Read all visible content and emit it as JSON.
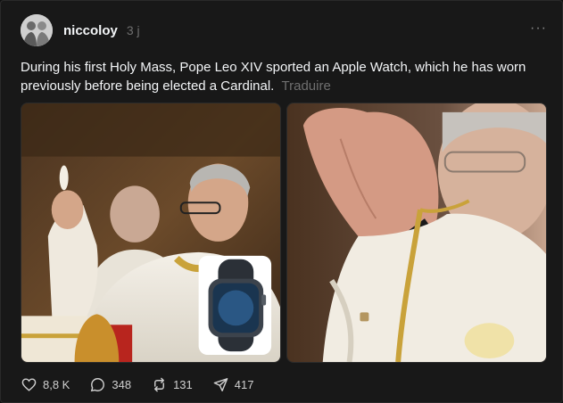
{
  "post": {
    "username": "niccoloy",
    "time": "3 j",
    "more_label": "···",
    "caption": "During his first Holy Mass, Pope Leo XIV sported an Apple Watch, which he has worn previously before being elected a Cardinal.",
    "translate_label": "Traduire",
    "media": [
      {
        "icon": "photo-mass-host-elevation"
      },
      {
        "icon": "photo-closeup-hands-watch"
      }
    ],
    "actions": {
      "likes": "8,8 K",
      "comments": "348",
      "reposts": "131",
      "shares": "417"
    },
    "colors": {
      "background": "#181818",
      "text": "#f3f5f7",
      "muted": "#6f6f6f"
    }
  }
}
